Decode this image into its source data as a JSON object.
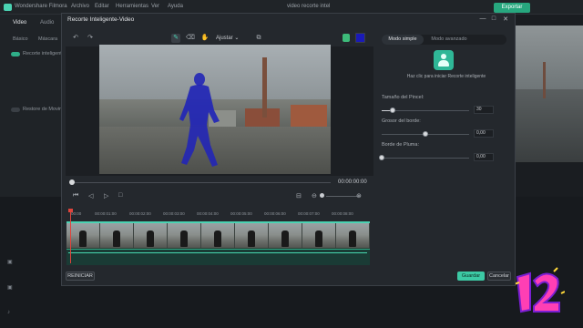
{
  "app": {
    "name": "Wondershare Filmora",
    "menus": [
      "Archivo",
      "Editar",
      "Herramientas",
      "Ver",
      "Ayuda"
    ],
    "project_title": "video recorte intel",
    "export_label": "Exportar",
    "accent": "#4ad2b2"
  },
  "left_panel": {
    "tabs": [
      "Video",
      "Audio"
    ],
    "subtabs": [
      "Básico",
      "Máscara"
    ],
    "options": [
      "Recorte inteligente",
      "Restore de Movimiento"
    ]
  },
  "dialog": {
    "title": "Recorte Inteligente-Video",
    "zoom_select": "Ajustar",
    "window_buttons": [
      "—",
      "□",
      "✕"
    ],
    "timecode": "00:00:00:00",
    "ruler_ticks": [
      "00:00",
      "00:00:01:00",
      "00:00:02:00",
      "00:00:03:00",
      "00:00:04:00",
      "00:00:05:00",
      "00:00:06:00",
      "00:00:07:00",
      "00:00:08:00"
    ],
    "reset_label": "REINICIAR",
    "save_label": "Guardar",
    "cancel_label": "Cancelar",
    "selection_color": "#1a1ab8"
  },
  "settings": {
    "mode_simple": "Modo simple",
    "mode_advanced": "Modo avanzado",
    "hint": "Haz clic para iniciar Recorte inteligente",
    "brush_size_label": "Tamaño del Pincel:",
    "brush_size_value": "30",
    "brush_size_fraction": 0.12,
    "edge_thickness_label": "Grosor del borde:",
    "edge_thickness_value": "0,00",
    "edge_thickness_fraction": 0.5,
    "feather_label": "Borde de Pluma:",
    "feather_value": "0,00",
    "feather_fraction": 0.0
  }
}
